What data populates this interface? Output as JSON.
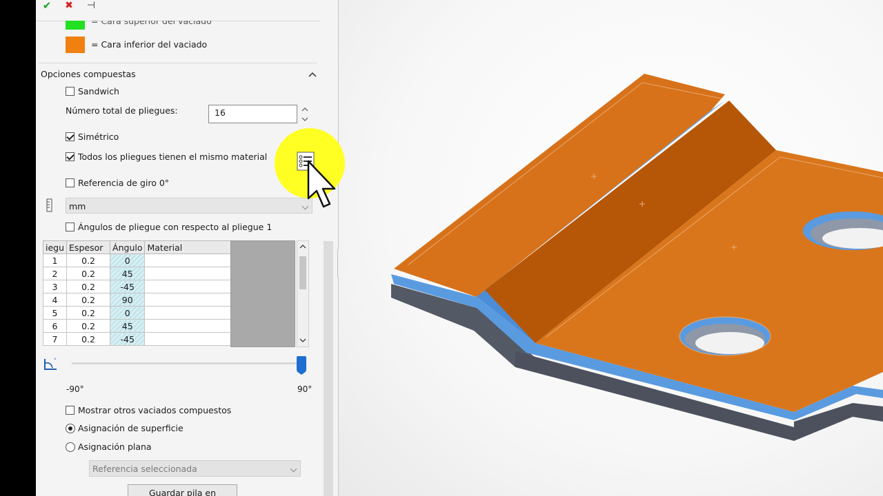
{
  "toolbar": {
    "ok": "✔",
    "cancel": "✖",
    "pin": "⊣"
  },
  "legend": {
    "top_face_label": "= Cara superior del vaciado",
    "bottom_face_label": "= Cara inferior del vaciado",
    "top_color": "#22e022",
    "bottom_color": "#f08010"
  },
  "composite": {
    "section_title": "Opciones compuestas",
    "sandwich_label": "Sandwich",
    "total_plies_label": "Número total de pliegues:",
    "total_plies_value": "16",
    "symmetric_label": "Simétrico",
    "same_material_label": "Todos los pliegues tienen el mismo material",
    "rotation_ref_label": "Referencia de giro 0°",
    "units_value": "mm",
    "angles_relative_label": "Ángulos de pliegue con respecto al pliegue 1"
  },
  "table": {
    "headers": [
      "iegu",
      "Espesor",
      "Ángulo",
      "Material"
    ],
    "rows": [
      [
        "1",
        "0.2",
        "0",
        ""
      ],
      [
        "2",
        "0.2",
        "45",
        ""
      ],
      [
        "3",
        "0.2",
        "-45",
        ""
      ],
      [
        "4",
        "0.2",
        "90",
        ""
      ],
      [
        "5",
        "0.2",
        "0",
        ""
      ],
      [
        "6",
        "0.2",
        "45",
        ""
      ],
      [
        "7",
        "0.2",
        "-45",
        ""
      ]
    ]
  },
  "slider": {
    "min_label": "-90°",
    "max_label": "90°",
    "value": 90
  },
  "options": {
    "show_others_label": "Mostrar otros vaciados compuestos",
    "surface_mapping_label": "Asignación de superficie",
    "flat_mapping_label": "Asignación plana",
    "reference_placeholder": "Referencia seleccionada",
    "save_stack_label": "Guardar pila en archivo..."
  },
  "colors": {
    "accent": "#1e6fd0",
    "part_orange": "#d7721a",
    "part_blue": "#5a9be0",
    "highlight": "#ffff18"
  }
}
